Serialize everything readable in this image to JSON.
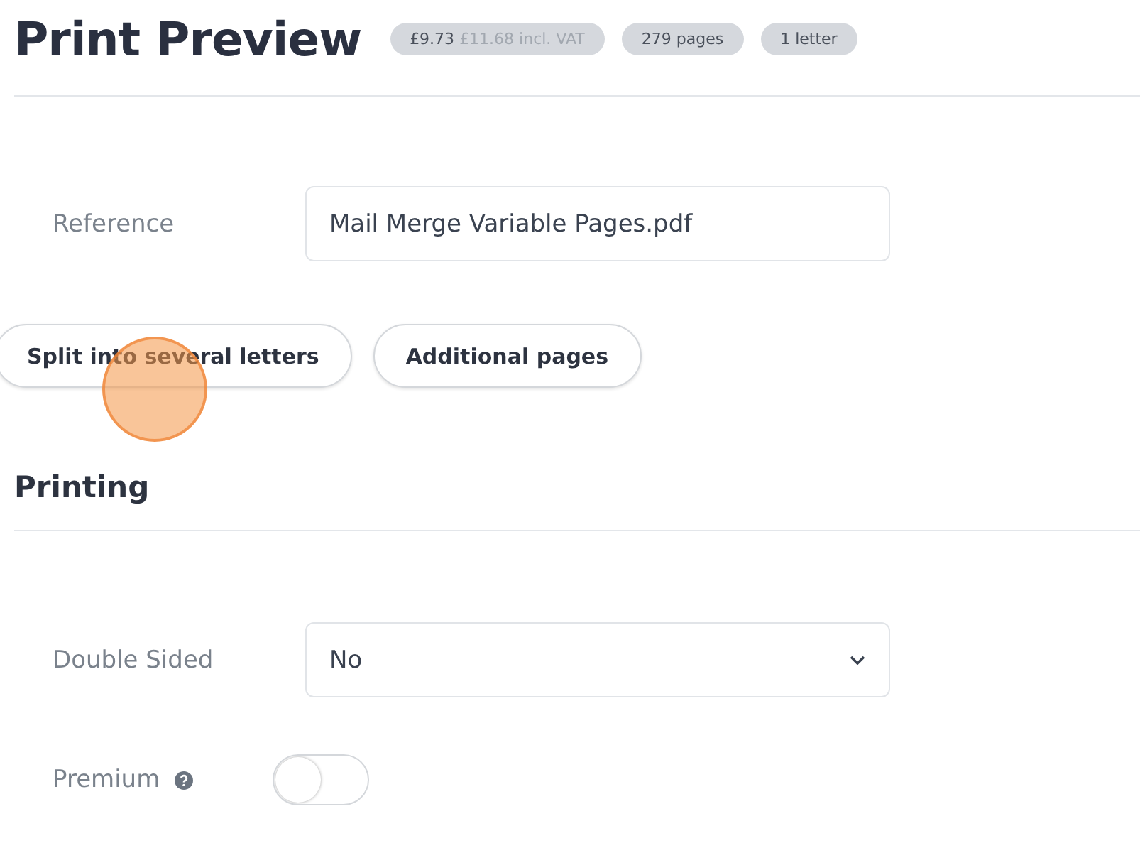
{
  "title": "Print Preview",
  "badges": [
    {
      "kind": "price",
      "price": "£9.73",
      "price_incl": "£11.68 incl. VAT"
    },
    {
      "kind": "plain",
      "text": "279 pages"
    },
    {
      "kind": "plain",
      "text": "1 letter"
    }
  ],
  "reference": {
    "label": "Reference",
    "value": "Mail Merge Variable Pages.pdf"
  },
  "actions": [
    "Split into several letters",
    "Additional pages"
  ],
  "printing": {
    "heading": "Printing",
    "fields": [
      {
        "kind": "select",
        "label": "Double Sided",
        "value": "No"
      },
      {
        "kind": "toggle",
        "label": "Premium",
        "help": true,
        "on": false
      }
    ]
  }
}
